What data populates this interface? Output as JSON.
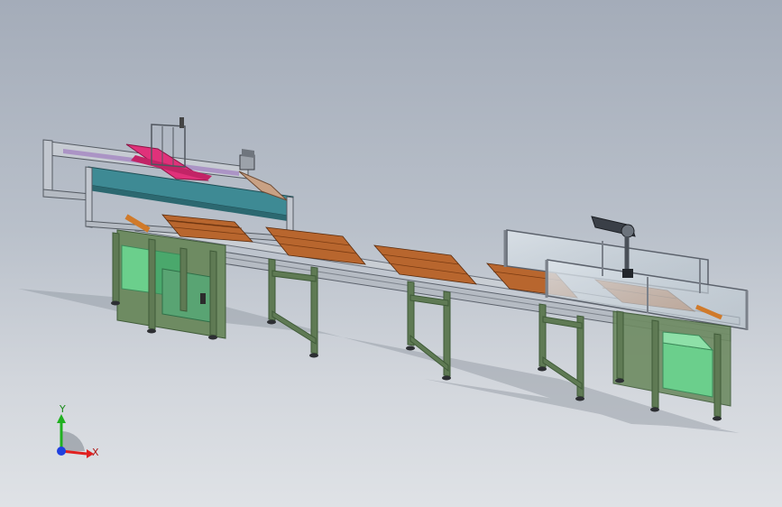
{
  "triad": {
    "x_label": "X",
    "y_label": "Y",
    "x_color": "#e02020",
    "y_color": "#20b020",
    "z_color": "#2040e0"
  },
  "palette": {
    "frame_green": "#5f7a54",
    "frame_green_dark": "#3f5a38",
    "aluminum": "#c9ced4",
    "aluminum_dark": "#8b9098",
    "cabinet": "#6bcf8c",
    "cabinet_dark": "#4aa86c",
    "gantry_teal": "#3e8a94",
    "gantry_pink": "#e0317a",
    "pallet_wood": "#b8662e",
    "glass": "#c8d4dc"
  }
}
